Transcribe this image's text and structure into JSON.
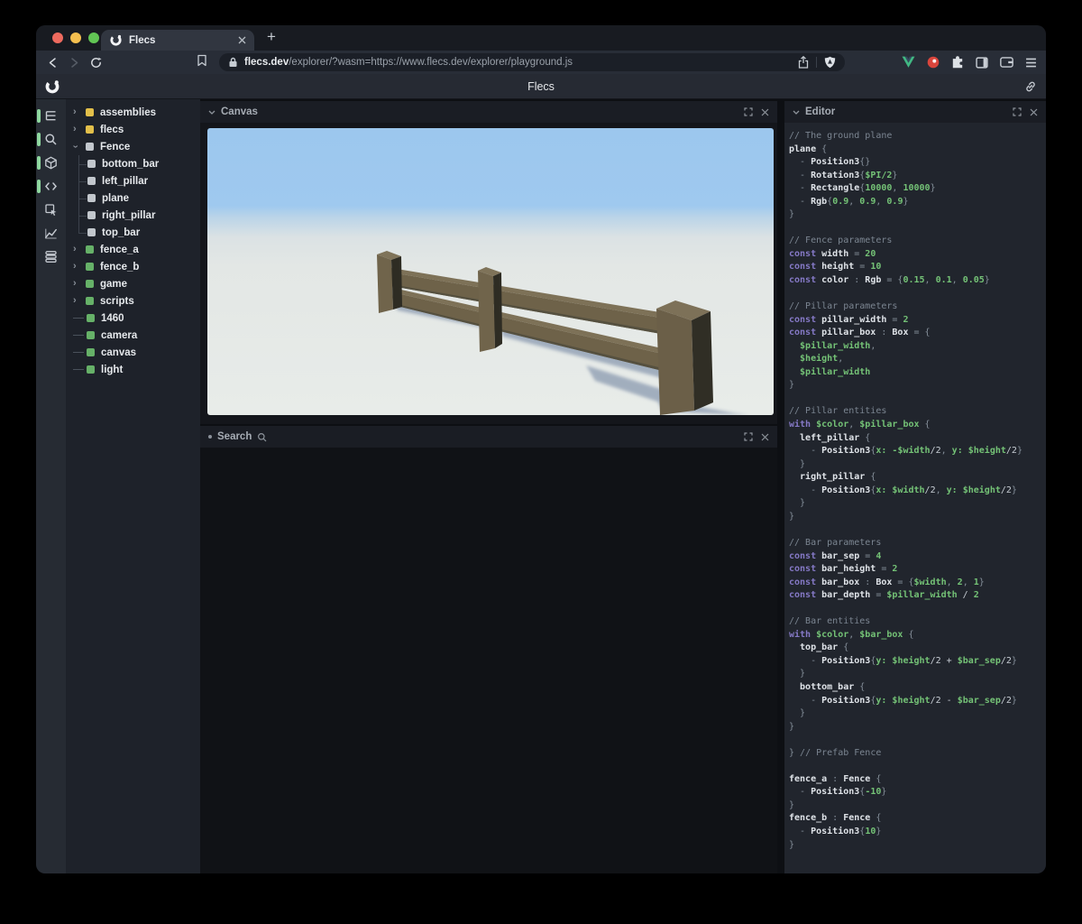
{
  "browser": {
    "tab": {
      "title": "Flecs"
    },
    "url": {
      "domain": "flecs.dev",
      "path": "/explorer/?wasm=https://www.flecs.dev/explorer/playground.js"
    },
    "toolbar_icons": [
      "back",
      "forward",
      "reload",
      "bookmark",
      "lock",
      "share",
      "brave-shield",
      "vue-extension",
      "red-extension",
      "extensions-puzzle",
      "sidebar",
      "wallet",
      "menu"
    ],
    "newtab_label": "+"
  },
  "app": {
    "title": "Flecs"
  },
  "sidebar": {
    "icons": [
      {
        "name": "entity-tree",
        "active": true
      },
      {
        "name": "search",
        "active": true
      },
      {
        "name": "scene-canvas",
        "active": true
      },
      {
        "name": "script-editor",
        "active": true
      },
      {
        "name": "inspect",
        "active": false
      },
      {
        "name": "stats-chart",
        "active": false
      },
      {
        "name": "data-tables",
        "active": false
      }
    ],
    "tree": [
      {
        "label": "assemblies",
        "color": "yellow",
        "state": "collapsed",
        "depth": 0
      },
      {
        "label": "flecs",
        "color": "yellow",
        "state": "collapsed",
        "depth": 0
      },
      {
        "label": "Fence",
        "color": "white",
        "state": "expanded",
        "depth": 0
      },
      {
        "label": "bottom_bar",
        "color": "white",
        "state": "child",
        "depth": 1
      },
      {
        "label": "left_pillar",
        "color": "white",
        "state": "child",
        "depth": 1
      },
      {
        "label": "plane",
        "color": "white",
        "state": "child",
        "depth": 1
      },
      {
        "label": "right_pillar",
        "color": "white",
        "state": "child",
        "depth": 1
      },
      {
        "label": "top_bar",
        "color": "white",
        "state": "child",
        "depth": 1,
        "last": true
      },
      {
        "label": "fence_a",
        "color": "green",
        "state": "collapsed",
        "depth": 0
      },
      {
        "label": "fence_b",
        "color": "green",
        "state": "collapsed",
        "depth": 0
      },
      {
        "label": "game",
        "color": "green",
        "state": "collapsed",
        "depth": 0
      },
      {
        "label": "scripts",
        "color": "green",
        "state": "collapsed",
        "depth": 0
      },
      {
        "label": "1460",
        "color": "green",
        "state": "leaf",
        "depth": 0
      },
      {
        "label": "camera",
        "color": "green",
        "state": "leaf",
        "depth": 0
      },
      {
        "label": "canvas",
        "color": "green",
        "state": "leaf",
        "depth": 0
      },
      {
        "label": "light",
        "color": "green",
        "state": "leaf",
        "depth": 0
      }
    ]
  },
  "panels": {
    "canvas": {
      "title": "Canvas"
    },
    "search": {
      "title": "Search"
    },
    "editor": {
      "title": "Editor",
      "code": [
        [
          [
            "cm",
            "// The ground plane"
          ]
        ],
        [
          [
            "id",
            "plane"
          ],
          [
            "pn",
            " {"
          ]
        ],
        [
          [
            "pn",
            "  - "
          ],
          [
            "id",
            "Position3"
          ],
          [
            "pn",
            "{}"
          ]
        ],
        [
          [
            "pn",
            "  - "
          ],
          [
            "id",
            "Rotation3"
          ],
          [
            "pn",
            "{"
          ],
          [
            "num",
            "$PI/2"
          ],
          [
            "pn",
            "}"
          ]
        ],
        [
          [
            "pn",
            "  - "
          ],
          [
            "id",
            "Rectangle"
          ],
          [
            "pn",
            "{"
          ],
          [
            "num",
            "10000"
          ],
          [
            "pn",
            ", "
          ],
          [
            "num",
            "10000"
          ],
          [
            "pn",
            "}"
          ]
        ],
        [
          [
            "pn",
            "  - "
          ],
          [
            "id",
            "Rgb"
          ],
          [
            "pn",
            "{"
          ],
          [
            "num",
            "0.9"
          ],
          [
            "pn",
            ", "
          ],
          [
            "num",
            "0.9"
          ],
          [
            "pn",
            ", "
          ],
          [
            "num",
            "0.9"
          ],
          [
            "pn",
            "}"
          ]
        ],
        [
          [
            "pn",
            "}"
          ]
        ],
        [],
        [
          [
            "cm",
            "// Fence parameters"
          ]
        ],
        [
          [
            "kw",
            "const "
          ],
          [
            "id",
            "width"
          ],
          [
            "pn",
            " = "
          ],
          [
            "num",
            "20"
          ]
        ],
        [
          [
            "kw",
            "const "
          ],
          [
            "id",
            "height"
          ],
          [
            "pn",
            " = "
          ],
          [
            "num",
            "10"
          ]
        ],
        [
          [
            "kw",
            "const "
          ],
          [
            "id",
            "color"
          ],
          [
            "pn",
            " : "
          ],
          [
            "id",
            "Rgb"
          ],
          [
            "pn",
            " = {"
          ],
          [
            "num",
            "0.15"
          ],
          [
            "pn",
            ", "
          ],
          [
            "num",
            "0.1"
          ],
          [
            "pn",
            ", "
          ],
          [
            "num",
            "0.05"
          ],
          [
            "pn",
            "}"
          ]
        ],
        [],
        [
          [
            "cm",
            "// Pillar parameters"
          ]
        ],
        [
          [
            "kw",
            "const "
          ],
          [
            "id",
            "pillar_width"
          ],
          [
            "pn",
            " = "
          ],
          [
            "num",
            "2"
          ]
        ],
        [
          [
            "kw",
            "const "
          ],
          [
            "id",
            "pillar_box"
          ],
          [
            "pn",
            " : "
          ],
          [
            "id",
            "Box"
          ],
          [
            "pn",
            " = {"
          ]
        ],
        [
          [
            "var",
            "  $pillar_width"
          ],
          [
            "pn",
            ","
          ]
        ],
        [
          [
            "var",
            "  $height"
          ],
          [
            "pn",
            ","
          ]
        ],
        [
          [
            "var",
            "  $pillar_width"
          ]
        ],
        [
          [
            "pn",
            "}"
          ]
        ],
        [],
        [
          [
            "cm",
            "// Pillar entities"
          ]
        ],
        [
          [
            "kw",
            "with "
          ],
          [
            "var",
            "$color"
          ],
          [
            "pn",
            ", "
          ],
          [
            "var",
            "$pillar_box"
          ],
          [
            "pn",
            " {"
          ]
        ],
        [
          [
            "id",
            "  left_pillar"
          ],
          [
            "pn",
            " {"
          ]
        ],
        [
          [
            "pn",
            "    - "
          ],
          [
            "id",
            "Position3"
          ],
          [
            "pn",
            "{"
          ],
          [
            "var",
            "x:"
          ],
          [
            "pl",
            " "
          ],
          [
            "var",
            "-$width"
          ],
          [
            "pl",
            "/2"
          ],
          [
            "pn",
            ", "
          ],
          [
            "var",
            "y:"
          ],
          [
            "pl",
            " "
          ],
          [
            "var",
            "$height"
          ],
          [
            "pl",
            "/2"
          ],
          [
            "pn",
            "}"
          ]
        ],
        [
          [
            "pn",
            "  }"
          ]
        ],
        [
          [
            "id",
            "  right_pillar"
          ],
          [
            "pn",
            " {"
          ]
        ],
        [
          [
            "pn",
            "    - "
          ],
          [
            "id",
            "Position3"
          ],
          [
            "pn",
            "{"
          ],
          [
            "var",
            "x:"
          ],
          [
            "pl",
            " "
          ],
          [
            "var",
            "$width"
          ],
          [
            "pl",
            "/2"
          ],
          [
            "pn",
            ", "
          ],
          [
            "var",
            "y:"
          ],
          [
            "pl",
            " "
          ],
          [
            "var",
            "$height"
          ],
          [
            "pl",
            "/2"
          ],
          [
            "pn",
            "}"
          ]
        ],
        [
          [
            "pn",
            "  }"
          ]
        ],
        [
          [
            "pn",
            "}"
          ]
        ],
        [],
        [
          [
            "cm",
            "// Bar parameters"
          ]
        ],
        [
          [
            "kw",
            "const "
          ],
          [
            "id",
            "bar_sep"
          ],
          [
            "pn",
            " = "
          ],
          [
            "num",
            "4"
          ]
        ],
        [
          [
            "kw",
            "const "
          ],
          [
            "id",
            "bar_height"
          ],
          [
            "pn",
            " = "
          ],
          [
            "num",
            "2"
          ]
        ],
        [
          [
            "kw",
            "const "
          ],
          [
            "id",
            "bar_box"
          ],
          [
            "pn",
            " : "
          ],
          [
            "id",
            "Box"
          ],
          [
            "pn",
            " = {"
          ],
          [
            "var",
            "$width"
          ],
          [
            "pn",
            ", "
          ],
          [
            "num",
            "2"
          ],
          [
            "pn",
            ", "
          ],
          [
            "num",
            "1"
          ],
          [
            "pn",
            "}"
          ]
        ],
        [
          [
            "kw",
            "const "
          ],
          [
            "id",
            "bar_depth"
          ],
          [
            "pn",
            " = "
          ],
          [
            "var",
            "$pillar_width"
          ],
          [
            "pl",
            " / "
          ],
          [
            "num",
            "2"
          ]
        ],
        [],
        [
          [
            "cm",
            "// Bar entities"
          ]
        ],
        [
          [
            "kw",
            "with "
          ],
          [
            "var",
            "$color"
          ],
          [
            "pn",
            ", "
          ],
          [
            "var",
            "$bar_box"
          ],
          [
            "pn",
            " {"
          ]
        ],
        [
          [
            "id",
            "  top_bar"
          ],
          [
            "pn",
            " {"
          ]
        ],
        [
          [
            "pn",
            "    - "
          ],
          [
            "id",
            "Position3"
          ],
          [
            "pn",
            "{"
          ],
          [
            "var",
            "y:"
          ],
          [
            "pl",
            " "
          ],
          [
            "var",
            "$height"
          ],
          [
            "pl",
            "/2 + "
          ],
          [
            "var",
            "$bar_sep"
          ],
          [
            "pl",
            "/2"
          ],
          [
            "pn",
            "}"
          ]
        ],
        [
          [
            "pn",
            "  }"
          ]
        ],
        [
          [
            "id",
            "  bottom_bar"
          ],
          [
            "pn",
            " {"
          ]
        ],
        [
          [
            "pn",
            "    - "
          ],
          [
            "id",
            "Position3"
          ],
          [
            "pn",
            "{"
          ],
          [
            "var",
            "y:"
          ],
          [
            "pl",
            " "
          ],
          [
            "var",
            "$height"
          ],
          [
            "pl",
            "/2 - "
          ],
          [
            "var",
            "$bar_sep"
          ],
          [
            "pl",
            "/2"
          ],
          [
            "pn",
            "}"
          ]
        ],
        [
          [
            "pn",
            "  }"
          ]
        ],
        [
          [
            "pn",
            "}"
          ]
        ],
        [],
        [
          [
            "pn",
            "} "
          ],
          [
            "cm",
            "// Prefab Fence"
          ]
        ],
        [],
        [
          [
            "id",
            "fence_a"
          ],
          [
            "pn",
            " : "
          ],
          [
            "id",
            "Fence"
          ],
          [
            "pn",
            " {"
          ]
        ],
        [
          [
            "pn",
            "  - "
          ],
          [
            "id",
            "Position3"
          ],
          [
            "pn",
            "{"
          ],
          [
            "num",
            "-10"
          ],
          [
            "pn",
            "}"
          ]
        ],
        [
          [
            "pn",
            "}"
          ]
        ],
        [
          [
            "id",
            "fence_b"
          ],
          [
            "pn",
            " : "
          ],
          [
            "id",
            "Fence"
          ],
          [
            "pn",
            " {"
          ]
        ],
        [
          [
            "pn",
            "  - "
          ],
          [
            "id",
            "Position3"
          ],
          [
            "pn",
            "{"
          ],
          [
            "num",
            "10"
          ],
          [
            "pn",
            "}"
          ]
        ],
        [
          [
            "pn",
            "}"
          ]
        ]
      ]
    }
  },
  "colors": {
    "accent_green_pill": "#8ed79e",
    "entity_yellow": "#e2bf4a",
    "entity_green": "#66b168",
    "entity_white": "#c2c7cd",
    "code_green": "#74c276",
    "code_purple": "#8579c6",
    "scene_sky": "#9dc8ee",
    "scene_ground": "#e4e8e6",
    "scene_fence_brown": "#6e6249",
    "scene_fence_dark": "#2e2c23"
  }
}
